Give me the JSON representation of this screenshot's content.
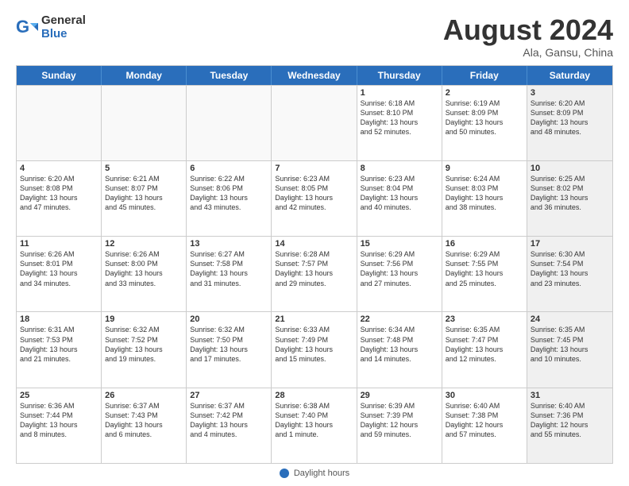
{
  "logo": {
    "general": "General",
    "blue": "Blue"
  },
  "title": "August 2024",
  "subtitle": "Ala, Gansu, China",
  "days_of_week": [
    "Sunday",
    "Monday",
    "Tuesday",
    "Wednesday",
    "Thursday",
    "Friday",
    "Saturday"
  ],
  "weeks": [
    [
      {
        "day": "",
        "info": "",
        "empty": true
      },
      {
        "day": "",
        "info": "",
        "empty": true
      },
      {
        "day": "",
        "info": "",
        "empty": true
      },
      {
        "day": "",
        "info": "",
        "empty": true
      },
      {
        "day": "1",
        "info": "Sunrise: 6:18 AM\nSunset: 8:10 PM\nDaylight: 13 hours\nand 52 minutes."
      },
      {
        "day": "2",
        "info": "Sunrise: 6:19 AM\nSunset: 8:09 PM\nDaylight: 13 hours\nand 50 minutes."
      },
      {
        "day": "3",
        "info": "Sunrise: 6:20 AM\nSunset: 8:09 PM\nDaylight: 13 hours\nand 48 minutes.",
        "shaded": true
      }
    ],
    [
      {
        "day": "4",
        "info": "Sunrise: 6:20 AM\nSunset: 8:08 PM\nDaylight: 13 hours\nand 47 minutes."
      },
      {
        "day": "5",
        "info": "Sunrise: 6:21 AM\nSunset: 8:07 PM\nDaylight: 13 hours\nand 45 minutes."
      },
      {
        "day": "6",
        "info": "Sunrise: 6:22 AM\nSunset: 8:06 PM\nDaylight: 13 hours\nand 43 minutes."
      },
      {
        "day": "7",
        "info": "Sunrise: 6:23 AM\nSunset: 8:05 PM\nDaylight: 13 hours\nand 42 minutes."
      },
      {
        "day": "8",
        "info": "Sunrise: 6:23 AM\nSunset: 8:04 PM\nDaylight: 13 hours\nand 40 minutes."
      },
      {
        "day": "9",
        "info": "Sunrise: 6:24 AM\nSunset: 8:03 PM\nDaylight: 13 hours\nand 38 minutes."
      },
      {
        "day": "10",
        "info": "Sunrise: 6:25 AM\nSunset: 8:02 PM\nDaylight: 13 hours\nand 36 minutes.",
        "shaded": true
      }
    ],
    [
      {
        "day": "11",
        "info": "Sunrise: 6:26 AM\nSunset: 8:01 PM\nDaylight: 13 hours\nand 34 minutes."
      },
      {
        "day": "12",
        "info": "Sunrise: 6:26 AM\nSunset: 8:00 PM\nDaylight: 13 hours\nand 33 minutes."
      },
      {
        "day": "13",
        "info": "Sunrise: 6:27 AM\nSunset: 7:58 PM\nDaylight: 13 hours\nand 31 minutes."
      },
      {
        "day": "14",
        "info": "Sunrise: 6:28 AM\nSunset: 7:57 PM\nDaylight: 13 hours\nand 29 minutes."
      },
      {
        "day": "15",
        "info": "Sunrise: 6:29 AM\nSunset: 7:56 PM\nDaylight: 13 hours\nand 27 minutes."
      },
      {
        "day": "16",
        "info": "Sunrise: 6:29 AM\nSunset: 7:55 PM\nDaylight: 13 hours\nand 25 minutes."
      },
      {
        "day": "17",
        "info": "Sunrise: 6:30 AM\nSunset: 7:54 PM\nDaylight: 13 hours\nand 23 minutes.",
        "shaded": true
      }
    ],
    [
      {
        "day": "18",
        "info": "Sunrise: 6:31 AM\nSunset: 7:53 PM\nDaylight: 13 hours\nand 21 minutes."
      },
      {
        "day": "19",
        "info": "Sunrise: 6:32 AM\nSunset: 7:52 PM\nDaylight: 13 hours\nand 19 minutes."
      },
      {
        "day": "20",
        "info": "Sunrise: 6:32 AM\nSunset: 7:50 PM\nDaylight: 13 hours\nand 17 minutes."
      },
      {
        "day": "21",
        "info": "Sunrise: 6:33 AM\nSunset: 7:49 PM\nDaylight: 13 hours\nand 15 minutes."
      },
      {
        "day": "22",
        "info": "Sunrise: 6:34 AM\nSunset: 7:48 PM\nDaylight: 13 hours\nand 14 minutes."
      },
      {
        "day": "23",
        "info": "Sunrise: 6:35 AM\nSunset: 7:47 PM\nDaylight: 13 hours\nand 12 minutes."
      },
      {
        "day": "24",
        "info": "Sunrise: 6:35 AM\nSunset: 7:45 PM\nDaylight: 13 hours\nand 10 minutes.",
        "shaded": true
      }
    ],
    [
      {
        "day": "25",
        "info": "Sunrise: 6:36 AM\nSunset: 7:44 PM\nDaylight: 13 hours\nand 8 minutes."
      },
      {
        "day": "26",
        "info": "Sunrise: 6:37 AM\nSunset: 7:43 PM\nDaylight: 13 hours\nand 6 minutes."
      },
      {
        "day": "27",
        "info": "Sunrise: 6:37 AM\nSunset: 7:42 PM\nDaylight: 13 hours\nand 4 minutes."
      },
      {
        "day": "28",
        "info": "Sunrise: 6:38 AM\nSunset: 7:40 PM\nDaylight: 13 hours\nand 1 minute."
      },
      {
        "day": "29",
        "info": "Sunrise: 6:39 AM\nSunset: 7:39 PM\nDaylight: 12 hours\nand 59 minutes."
      },
      {
        "day": "30",
        "info": "Sunrise: 6:40 AM\nSunset: 7:38 PM\nDaylight: 12 hours\nand 57 minutes."
      },
      {
        "day": "31",
        "info": "Sunrise: 6:40 AM\nSunset: 7:36 PM\nDaylight: 12 hours\nand 55 minutes.",
        "shaded": true
      }
    ]
  ],
  "footer": {
    "label": "Daylight hours"
  }
}
